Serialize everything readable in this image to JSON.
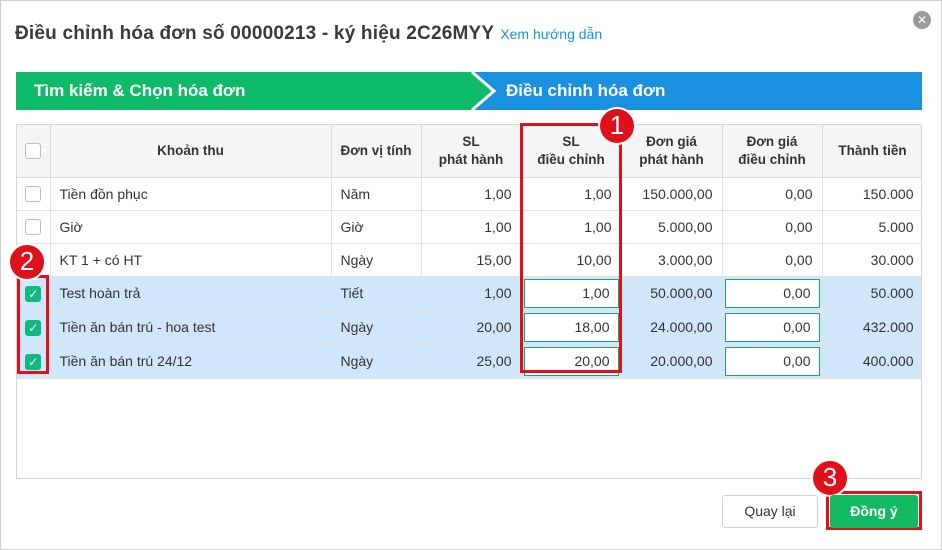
{
  "dialog": {
    "title": "Điều chỉnh hóa đơn số 00000213 - ký hiệu 2C26MYY",
    "guide_link": "Xem hướng dẫn",
    "close_icon": "close-circle-icon"
  },
  "steps": [
    {
      "label": "Tìm kiếm & Chọn hóa đơn",
      "color": "#0fba68"
    },
    {
      "label": "Điều chỉnh hóa đơn",
      "color": "#1a90e0"
    }
  ],
  "table": {
    "headers": {
      "khoan_thu": "Khoản thu",
      "don_vi": "Đơn vị tính",
      "sl_phat_hanh": [
        "SL",
        "phát hành"
      ],
      "sl_dieu_chinh": [
        "SL",
        "điều chỉnh"
      ],
      "dg_phat_hanh": [
        "Đơn giá",
        "phát hành"
      ],
      "dg_dieu_chinh": [
        "Đơn giá",
        "điều chỉnh"
      ],
      "thanh_tien": "Thành tiền"
    },
    "rows": [
      {
        "checked": false,
        "name": "Tiền đồn phục",
        "unit": "Năm",
        "sl_ph": "1,00",
        "sl_dc": "1,00",
        "dg_ph": "150.000,00",
        "dg_dc": "0,00",
        "total": "150.000"
      },
      {
        "checked": false,
        "name": "Giờ",
        "unit": "Giờ",
        "sl_ph": "1,00",
        "sl_dc": "1,00",
        "dg_ph": "5.000,00",
        "dg_dc": "0,00",
        "total": "5.000"
      },
      {
        "checked": false,
        "name": "KT 1 + có HT",
        "unit": "Ngày",
        "sl_ph": "15,00",
        "sl_dc": "10,00",
        "dg_ph": "3.000,00",
        "dg_dc": "0,00",
        "total": "30.000"
      },
      {
        "checked": true,
        "name": "Test hoàn trả",
        "unit": "Tiết",
        "sl_ph": "1,00",
        "sl_dc": "1,00",
        "dg_ph": "50.000,00",
        "dg_dc": "0,00",
        "total": "50.000"
      },
      {
        "checked": true,
        "name": "Tiền ăn bán trú - hoa test",
        "unit": "Ngày",
        "sl_ph": "20,00",
        "sl_dc": "18,00",
        "dg_ph": "24.000,00",
        "dg_dc": "0,00",
        "total": "432.000"
      },
      {
        "checked": true,
        "name": "Tiền ăn bán trú 24/12",
        "unit": "Ngày",
        "sl_ph": "25,00",
        "sl_dc": "20,00",
        "dg_ph": "20.000,00",
        "dg_dc": "0,00",
        "total": "400.000"
      }
    ]
  },
  "annotations": [
    "1",
    "2",
    "3"
  ],
  "buttons": {
    "back": "Quay lại",
    "ok": "Đồng ý"
  },
  "colors": {
    "accent_green": "#10b962",
    "accent_blue": "#1a90e0",
    "highlight_red": "#e0101a",
    "selected_row": "#cfe6fb"
  }
}
